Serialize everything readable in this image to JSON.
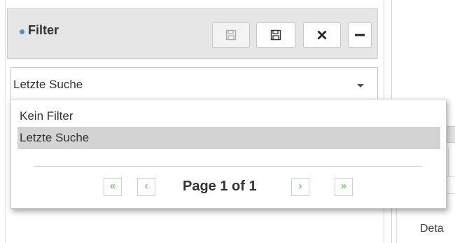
{
  "filter_panel": {
    "title": "Filter",
    "bullet_color": "#4a90d9",
    "toolbar": [
      {
        "name": "save-disabled",
        "icon": "floppy-disk-icon",
        "state": "disabled"
      },
      {
        "name": "save-as",
        "icon": "floppy-disk-icon",
        "state": "enabled"
      },
      {
        "name": "clear",
        "icon": "close-x-icon",
        "state": "enabled"
      },
      {
        "name": "collapse",
        "icon": "minus-icon",
        "state": "enabled"
      }
    ]
  },
  "filter_select": {
    "selected": "Letzte Suche",
    "caret_icon": "caret-down-icon"
  },
  "dropdown": {
    "options": [
      {
        "label": "Kein Filter",
        "selected": false
      },
      {
        "label": "Letzte Suche",
        "selected": true
      }
    ],
    "pager": {
      "text": "Page 1 of 1",
      "first_icon": "double-chevron-left-icon",
      "prev_icon": "chevron-left-icon",
      "next_icon": "chevron-right-icon",
      "last_icon": "double-chevron-right-icon",
      "accent": "#7bc67b"
    }
  },
  "right_panel": {
    "details_label": "Deta"
  }
}
